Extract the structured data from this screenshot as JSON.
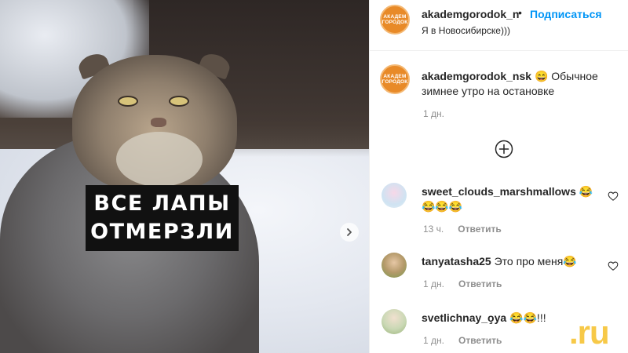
{
  "post_image": {
    "caption_lines": [
      "ВСЕ ЛАПЫ",
      "ОТМЕРЗЛИ"
    ],
    "next_icon": "chevron-right-icon"
  },
  "header": {
    "avatar_text": [
      "АКАДЕМ",
      "ГОРОДОК"
    ],
    "username": "akademgorodok_n",
    "separator": "•",
    "follow_label": "Подписаться",
    "location": "Я в Новосибирске)))"
  },
  "post": {
    "avatar_text": [
      "АКАДЕМ",
      "ГОРОДОК"
    ],
    "username": "akademgorodok_nsk",
    "text": "😄 Обычное зимнее утро на остановке",
    "time": "1 дн."
  },
  "load_more_icon": "plus-circle-icon",
  "comments": [
    {
      "username": "sweet_clouds_marshmallows",
      "text": "😂 😂😂😂",
      "time": "13 ч.",
      "reply_label": "Ответить",
      "avatar_color": "#cfe3f2"
    },
    {
      "username": "tanyatasha25",
      "text": "Это про меня😂",
      "time": "1 дн.",
      "reply_label": "Ответить",
      "avatar_color": "#b59a6b"
    },
    {
      "username": "svetlichnay_o̧ya",
      "text": "😂😂!!!",
      "time": "1 дн.",
      "reply_label": "Ответить",
      "avatar_color": "#9bb37a"
    }
  ],
  "watermark": ".ru",
  "colors": {
    "accent_blue": "#0095f6",
    "brand_orange": "#e88a28",
    "muted_text": "#8e8e8e",
    "watermark_yellow": "#f7c948"
  }
}
